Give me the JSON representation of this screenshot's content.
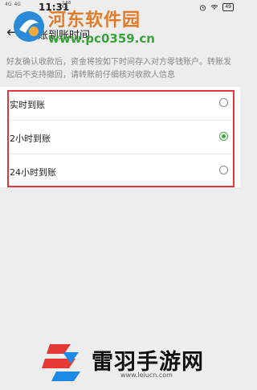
{
  "status_bar": {
    "signal_1": "4G",
    "signal_2": "4G",
    "time": "11:31",
    "net_rate": "2.68",
    "net_unit": "K/s",
    "battery": "49"
  },
  "nav": {
    "title": "转账到账时间"
  },
  "watermark": {
    "name": "河东软件园",
    "url": "www.pc0359.cn"
  },
  "description": "好友确认收款后，资金将按如下时间存入对方零钱账户。转账发起后不支持撤回，请转账前仔细核对收款人信息",
  "options": [
    {
      "label": "实时到账",
      "checked": false
    },
    {
      "label": "2小时到账",
      "checked": true
    },
    {
      "label": "24小时到账",
      "checked": false
    }
  ],
  "bottom_logo": {
    "name": "雷羽手游网",
    "url": "www.leiucn.com"
  },
  "colors": {
    "accent": "#39a93b",
    "highlight": "#e0383e"
  }
}
